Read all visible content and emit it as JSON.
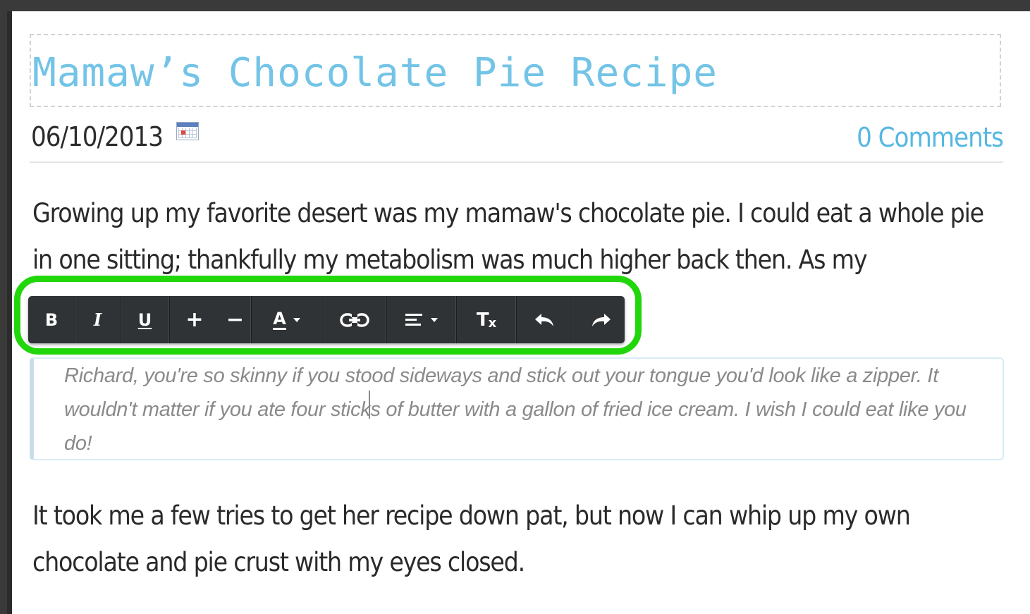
{
  "post": {
    "title": "Mamaw’s Chocolate Pie Recipe",
    "date": "06/10/2013",
    "comments_link": "0 Comments",
    "paragraph_1": "Growing up my favorite desert was my mamaw's chocolate pie. I could eat a whole pie in one sitting; thankfully my metabolism was much higher back then. As my",
    "blockquote": "Richard, you're so skinny if you stood sideways and stick out your tongue you'd look like a zipper. It wouldn't matter if you ate four sticks of butter with a gallon of fried ice cream. I wish I could eat like you do!",
    "paragraph_2": "It took me a few tries to get her recipe down pat, but now I can whip up my own chocolate and pie crust with my eyes closed."
  },
  "toolbar": {
    "bold_label": "B",
    "italic_label": "I",
    "underline_label": "U",
    "increase_size_label": "+",
    "decrease_size_label": "−",
    "text_color_label": "A",
    "clear_format_t": "T",
    "clear_format_x": "x"
  },
  "icons": {
    "calendar": "calendar-icon",
    "link": "link-icon",
    "align": "align-left-icon",
    "undo": "undo-icon",
    "redo": "redo-icon",
    "dropdown": "caret-down-icon"
  },
  "colors": {
    "title": "#73c4e6",
    "comments_link": "#56b7e2",
    "toolbar_bg": "#2f3335",
    "highlight": "#22d60c",
    "quote_text": "#8a8a8a"
  }
}
